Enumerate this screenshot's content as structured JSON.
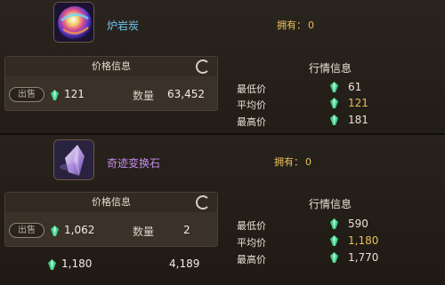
{
  "colors": {
    "gem_green": "#3fd08a",
    "own_label": "#e7c05a",
    "item1_name": "#6fc4e6",
    "item2_name": "#c58cf0",
    "highlight_value": "#e7c05a"
  },
  "items": [
    {
      "name": "炉岩炭",
      "icon": "coal-orb-icon",
      "owned_label": "拥有：",
      "owned_count": "0",
      "price_panel": {
        "header": "价格信息",
        "sell_label": "出售",
        "price": "121",
        "quantity_label": "数量",
        "quantity": "63,452"
      },
      "market": {
        "title": "行情信息",
        "rows": [
          {
            "label": "最低价",
            "value": "61"
          },
          {
            "label": "平均价",
            "value": "121"
          },
          {
            "label": "最高价",
            "value": "181"
          }
        ]
      }
    },
    {
      "name": "奇迹变换石",
      "icon": "miracle-crystal-icon",
      "owned_label": "拥有：",
      "owned_count": "0",
      "price_panel": {
        "header": "价格信息",
        "sell_label": "出售",
        "price": "1,062",
        "quantity_label": "数量",
        "quantity": "2"
      },
      "market": {
        "title": "行情信息",
        "rows": [
          {
            "label": "最低价",
            "value": "590"
          },
          {
            "label": "平均价",
            "value": "1,180"
          },
          {
            "label": "最高价",
            "value": "1,770"
          }
        ]
      },
      "extra_listing": {
        "price": "1,180",
        "quantity": "4,189"
      }
    }
  ]
}
